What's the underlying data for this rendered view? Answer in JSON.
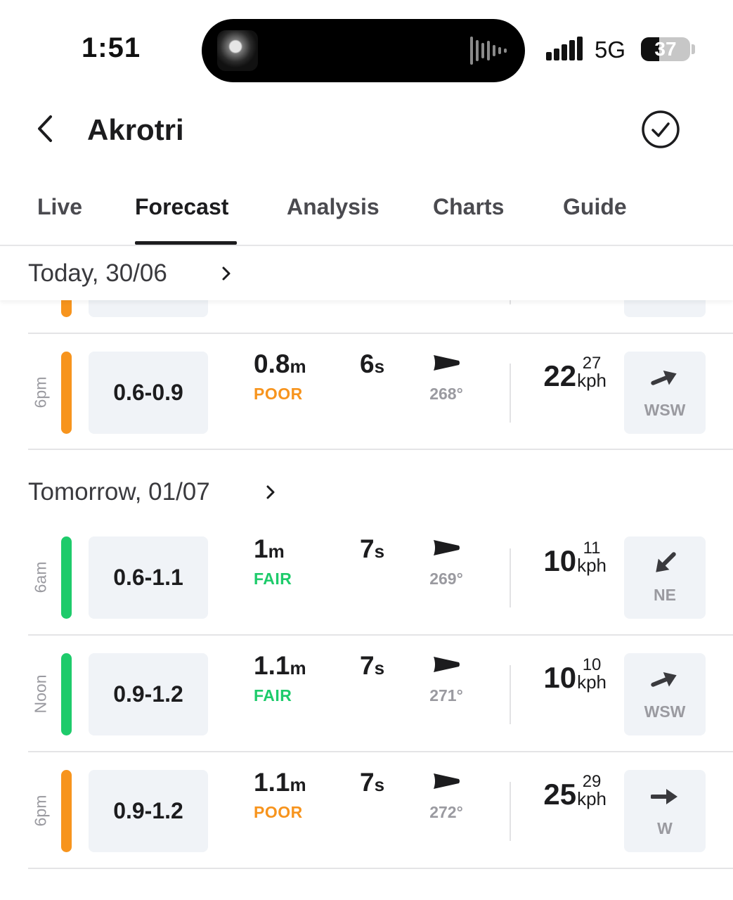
{
  "status_bar": {
    "time": "1:51",
    "network": "5G",
    "battery": "37",
    "battery_fraction": 0.37
  },
  "header": {
    "title": "Akrotri",
    "back_icon": "chevron-left-icon",
    "favorite_icon": "check-circle-icon"
  },
  "tabs": [
    {
      "label": "Live"
    },
    {
      "label": "Forecast",
      "active": true
    },
    {
      "label": "Analysis"
    },
    {
      "label": "Charts"
    },
    {
      "label": "Guide"
    }
  ],
  "colors": {
    "poor": "#f7941d",
    "fair": "#1ecb6b",
    "label_gray": "#9a9aa0",
    "box_bg": "#f0f3f7"
  },
  "days": [
    {
      "label": "Today, 30/06",
      "rows": [
        {
          "time": "6pm",
          "range": "0.6-0.9",
          "swell": "0.8",
          "swell_unit": "m",
          "quality": "POOR",
          "period": "6",
          "period_unit": "s",
          "swell_deg": "268°",
          "wind": "22",
          "gust": "27",
          "wind_unit": "kph",
          "wind_dir": "WSW"
        }
      ]
    },
    {
      "label": "Tomorrow, 01/07",
      "rows": [
        {
          "time": "6am",
          "range": "0.6-1.1",
          "swell": "1",
          "swell_unit": "m",
          "quality": "FAIR",
          "period": "7",
          "period_unit": "s",
          "swell_deg": "269°",
          "wind": "10",
          "gust": "11",
          "wind_unit": "kph",
          "wind_dir": "NE"
        },
        {
          "time": "Noon",
          "range": "0.9-1.2",
          "swell": "1.1",
          "swell_unit": "m",
          "quality": "FAIR",
          "period": "7",
          "period_unit": "s",
          "swell_deg": "271°",
          "wind": "10",
          "gust": "10",
          "wind_unit": "kph",
          "wind_dir": "WSW"
        },
        {
          "time": "6pm",
          "range": "0.9-1.2",
          "swell": "1.1",
          "swell_unit": "m",
          "quality": "POOR",
          "period": "7",
          "period_unit": "s",
          "swell_deg": "272°",
          "wind": "25",
          "gust": "29",
          "wind_unit": "kph",
          "wind_dir": "W"
        }
      ]
    }
  ]
}
